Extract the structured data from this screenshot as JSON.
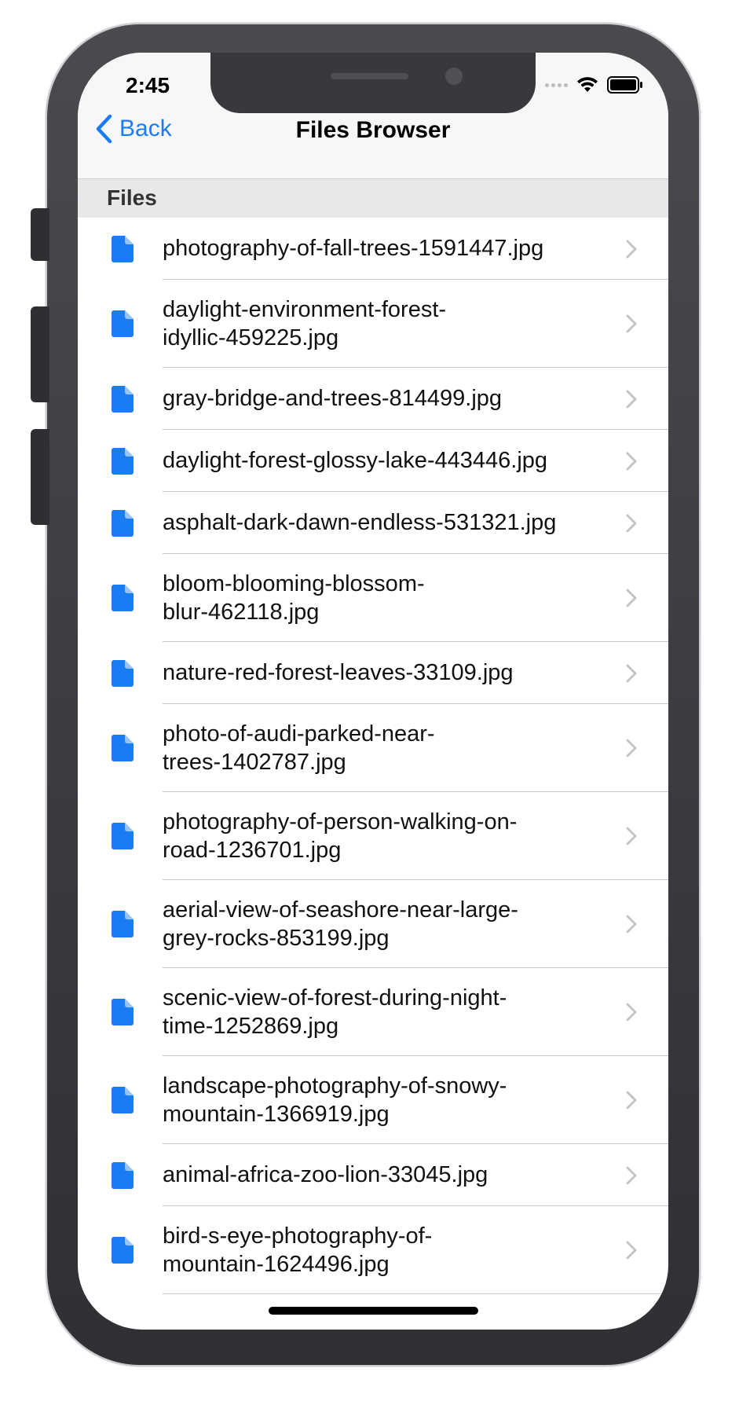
{
  "status_bar": {
    "time": "2:45",
    "icons": [
      "signal-dots-icon",
      "wifi-icon",
      "battery-icon"
    ]
  },
  "navbar": {
    "back_label": "Back",
    "title": "Files Browser"
  },
  "section": {
    "header": "Files"
  },
  "files": [
    {
      "name": "photography-of-fall-trees-1591447.jpg",
      "lines": 1
    },
    {
      "name": "daylight-environment-forest-idyllic-459225.jpg",
      "line1": "daylight-environment-forest-",
      "line2": "idyllic-459225.jpg",
      "lines": 2
    },
    {
      "name": "gray-bridge-and-trees-814499.jpg",
      "lines": 1
    },
    {
      "name": "daylight-forest-glossy-lake-443446.jpg",
      "lines": 1
    },
    {
      "name": "asphalt-dark-dawn-endless-531321.jpg",
      "lines": 1
    },
    {
      "name": "bloom-blooming-blossom-blur-462118.jpg",
      "line1": "bloom-blooming-blossom-",
      "line2": "blur-462118.jpg",
      "lines": 2
    },
    {
      "name": "nature-red-forest-leaves-33109.jpg",
      "lines": 1
    },
    {
      "name": "photo-of-audi-parked-near-trees-1402787.jpg",
      "line1": "photo-of-audi-parked-near-",
      "line2": "trees-1402787.jpg",
      "lines": 2
    },
    {
      "name": "photography-of-person-walking-on-road-1236701.jpg",
      "line1": "photography-of-person-walking-on-",
      "line2": "road-1236701.jpg",
      "lines": 2
    },
    {
      "name": "aerial-view-of-seashore-near-large-grey-rocks-853199.jpg",
      "line1": "aerial-view-of-seashore-near-large-",
      "line2": "grey-rocks-853199.jpg",
      "lines": 2
    },
    {
      "name": "scenic-view-of-forest-during-night-time-1252869.jpg",
      "line1": "scenic-view-of-forest-during-night-",
      "line2": "time-1252869.jpg",
      "lines": 2
    },
    {
      "name": "landscape-photography-of-snowy-mountain-1366919.jpg",
      "line1": "landscape-photography-of-snowy-",
      "line2": "mountain-1366919.jpg",
      "lines": 2
    },
    {
      "name": "animal-africa-zoo-lion-33045.jpg",
      "lines": 1
    },
    {
      "name": "bird-s-eye-photography-of-mountain-1624496.jpg",
      "line1": "bird-s-eye-photography-of-",
      "line2": "mountain-1624496.jpg",
      "lines": 2
    }
  ],
  "colors": {
    "accent": "#1a7cf5",
    "chevron": "#c4c4c7",
    "section_bg": "#e8e8e9",
    "navbar_bg": "#f7f7f7"
  }
}
